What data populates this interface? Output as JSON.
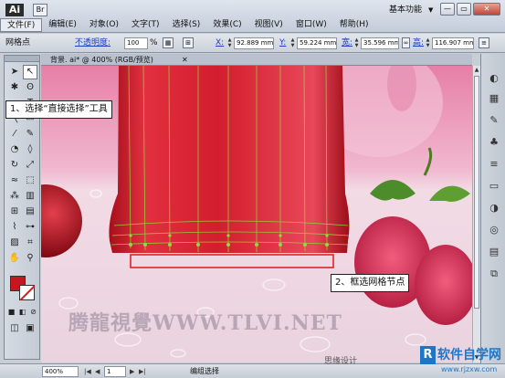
{
  "app": {
    "logo": "Ai",
    "bridge_label": "Br",
    "workspace": "基本功能"
  },
  "menu": [
    "文件(F)",
    "编辑(E)",
    "对象(O)",
    "文字(T)",
    "选择(S)",
    "效果(C)",
    "视图(V)",
    "窗口(W)",
    "帮助(H)"
  ],
  "window_buttons": [
    "—",
    "▭",
    "✕"
  ],
  "control_bar": {
    "label": "网格点",
    "opacity_label": "不透明度:",
    "opacity_value": "100",
    "opacity_unit": "%",
    "x_label": "X:",
    "x_value": "92.889 mm",
    "y_label": "Y:",
    "y_value": "59.224 mm",
    "w_label": "宽:",
    "w_value": "35.596 mm",
    "h_label": "高:",
    "h_value": "116.907 mm"
  },
  "document_tab": {
    "title": "背景. ai* @ 400% (RGB/预览)",
    "close": "✕"
  },
  "status_bar": {
    "zoom": "400%",
    "page": "1",
    "status": "编组选择"
  },
  "callouts": {
    "step1": "1、选择“直接选择”工具",
    "step2": "2、框选网格节点"
  },
  "watermarks": {
    "main": "腾龍視覺WWW.TLVI.NET",
    "site": "思缘设计",
    "logo_box": "R",
    "logo_text": "软件自学网",
    "logo_url": "www.rjzxw.com"
  },
  "colors": {
    "fill": "#c4171f",
    "stroke": "#ffffff",
    "mesh": "#8ddc3c",
    "selection": "#e0151b"
  }
}
